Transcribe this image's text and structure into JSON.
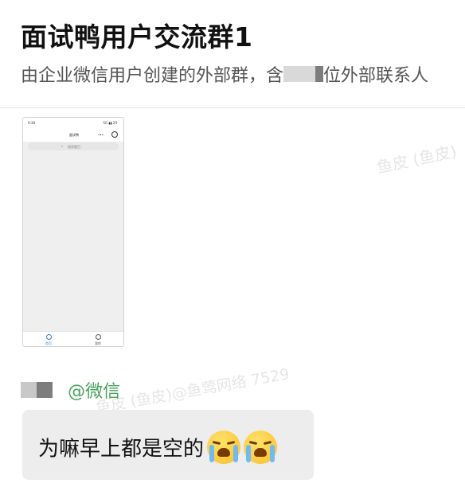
{
  "header": {
    "title": "面试鸭用户交流群1",
    "subtitle_before": "由企业微信用户创建的外部群，含",
    "subtitle_after": "位外部联系人"
  },
  "watermarks": [
    "鱼皮 (鱼皮)",
    "鱼皮 (鱼皮)@鱼莺网络 7529"
  ],
  "shared_image": {
    "status_time": "9:38",
    "status_right": "5G ▮▮ 29",
    "nav_title": "面试鸭",
    "nav_dots": "•••",
    "search_icon": "search-icon",
    "search_placeholder": "搜索题目",
    "tabs": [
      {
        "label": "首页",
        "icon": "home-icon"
      },
      {
        "label": "我的",
        "icon": "user-icon"
      }
    ]
  },
  "message": {
    "mention": "@微信",
    "text": "为嘛早上都是空的",
    "emoji": "loudly-crying-face-icon",
    "bubble_color": "#ededed",
    "mention_color": "#46a35e"
  }
}
